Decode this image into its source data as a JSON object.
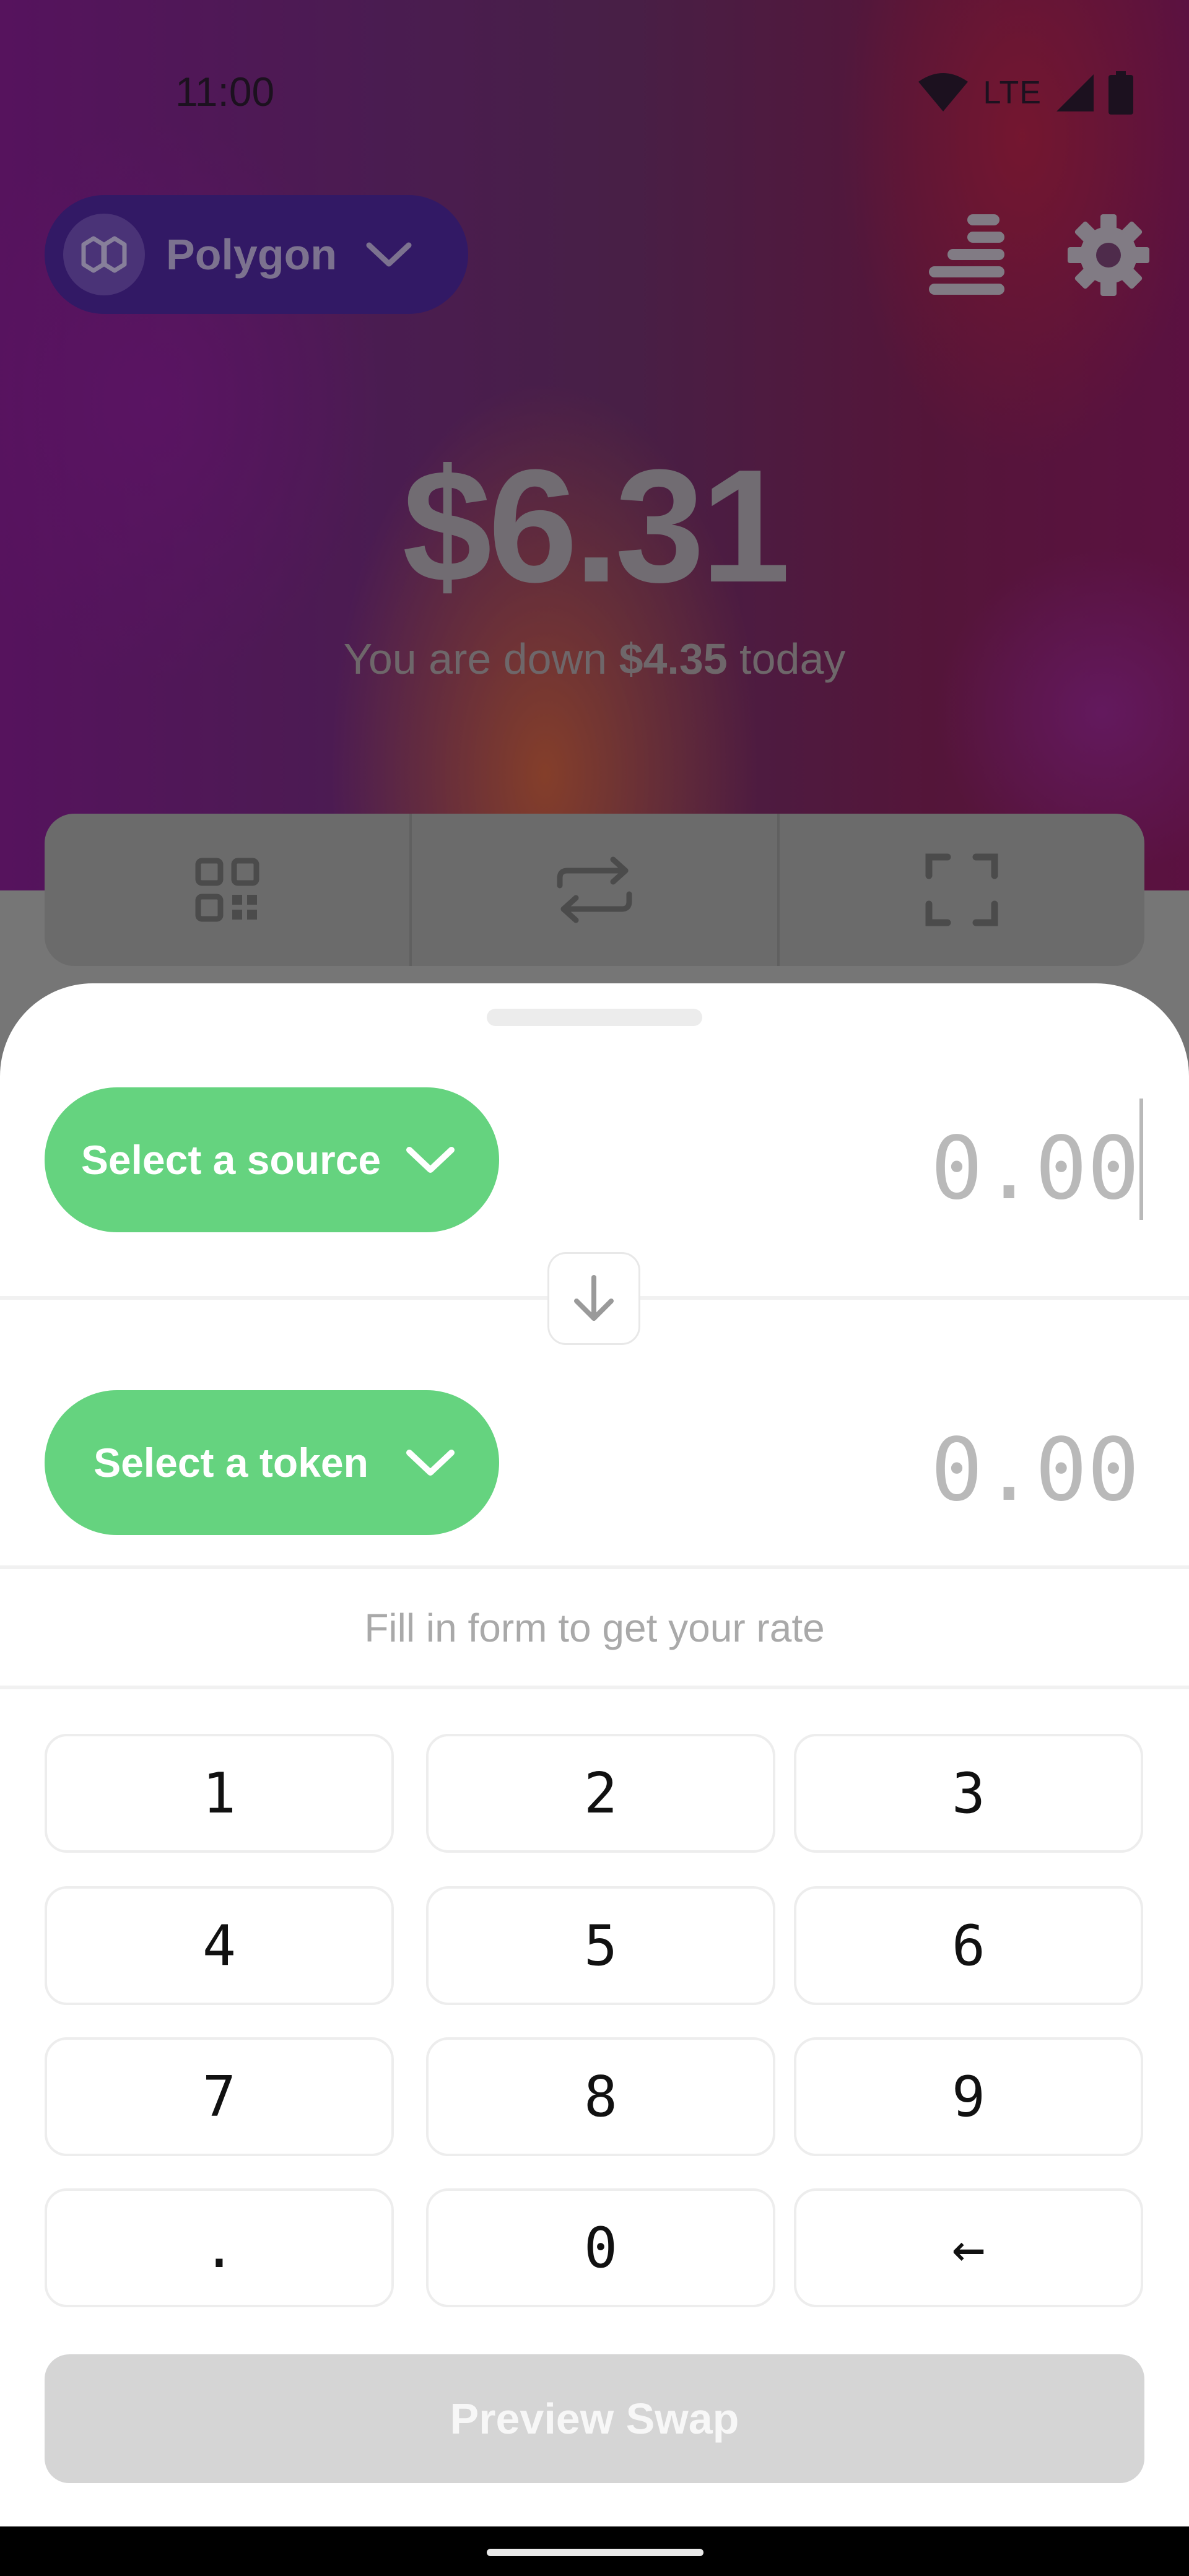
{
  "status_bar": {
    "time": "11:00",
    "network": "LTE"
  },
  "network_selector": {
    "name": "Polygon",
    "icon": "polygon-logo-icon"
  },
  "header_icons": {
    "history": "stack-icon",
    "settings": "gear-icon"
  },
  "balance": {
    "amount": "$6.31",
    "change_prefix": "You are down ",
    "change_value": "$4.35",
    "change_suffix": " today"
  },
  "actions": [
    {
      "name": "receive",
      "icon": "qr-code-icon"
    },
    {
      "name": "swap",
      "icon": "swap-arrows-icon"
    },
    {
      "name": "scan",
      "icon": "scan-frame-icon"
    }
  ],
  "swap": {
    "source_label": "Select a source",
    "source_amount": "0.00",
    "token_label": "Select a token",
    "token_amount": "0.00",
    "rate_hint": "Fill in form to get your rate"
  },
  "keypad": [
    "1",
    "2",
    "3",
    "4",
    "5",
    "6",
    "7",
    "8",
    "9",
    ".",
    "0",
    "←"
  ],
  "preview_button": "Preview Swap",
  "colors": {
    "accent_green": "#65d37f",
    "network_pill": "#4b2596"
  }
}
